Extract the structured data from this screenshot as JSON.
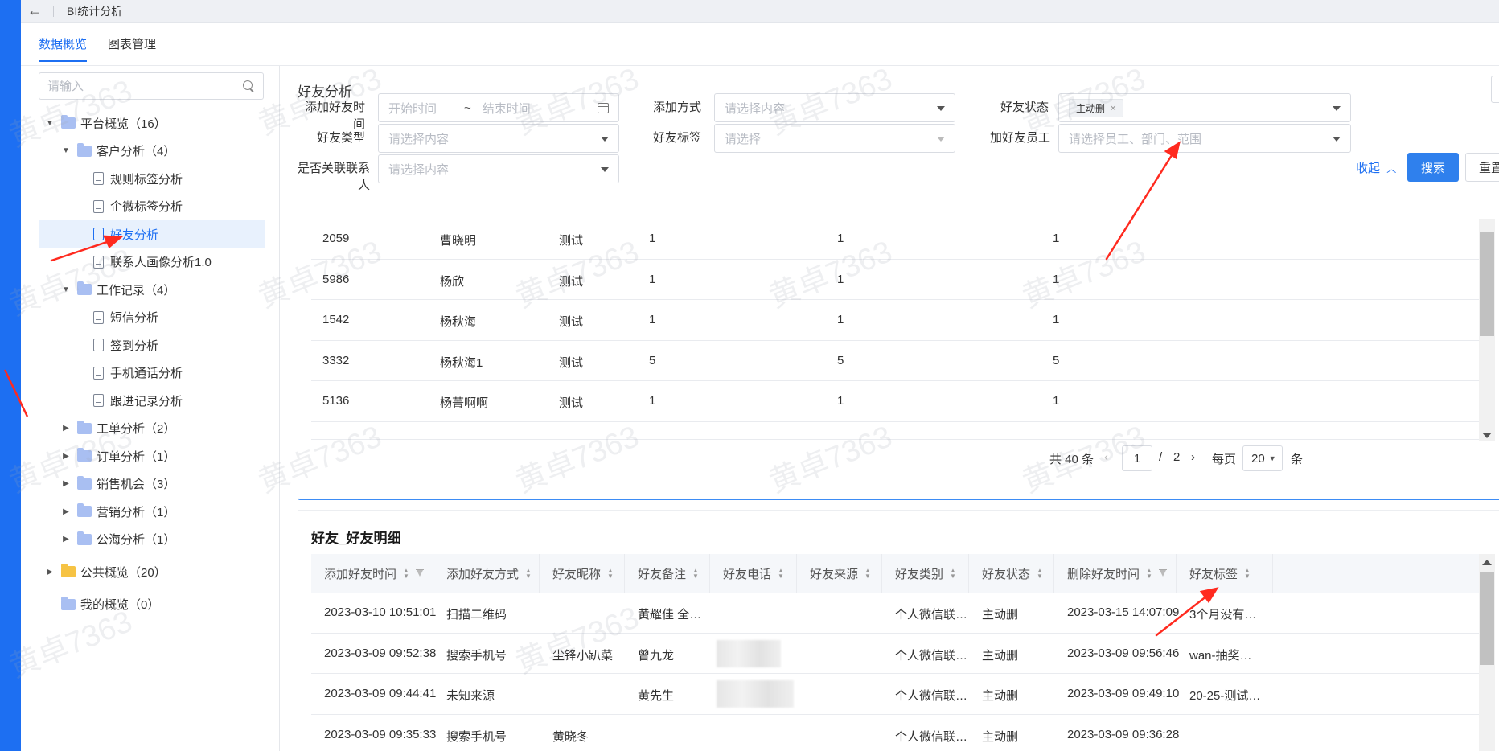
{
  "topbar": {
    "back_icon": "arrow-left-icon",
    "title": "BI统计分析"
  },
  "tabs": [
    {
      "label": "数据概览",
      "active": true
    },
    {
      "label": "图表管理",
      "active": false
    }
  ],
  "sidebar": {
    "search_placeholder": "请输入",
    "tree": [
      {
        "label": "平台概览（16）",
        "level": 0,
        "type": "folder",
        "expanded": true
      },
      {
        "label": "客户分析（4）",
        "level": 1,
        "type": "folder",
        "expanded": true
      },
      {
        "label": "规则标签分析",
        "level": 2,
        "type": "doc"
      },
      {
        "label": "企微标签分析",
        "level": 2,
        "type": "doc"
      },
      {
        "label": "好友分析",
        "level": 2,
        "type": "doc",
        "selected": true
      },
      {
        "label": "联系人画像分析1.0",
        "level": 2,
        "type": "doc"
      },
      {
        "label": "工作记录（4）",
        "level": 1,
        "type": "folder",
        "expanded": true
      },
      {
        "label": "短信分析",
        "level": 2,
        "type": "doc"
      },
      {
        "label": "签到分析",
        "level": 2,
        "type": "doc"
      },
      {
        "label": "手机通话分析",
        "level": 2,
        "type": "doc"
      },
      {
        "label": "跟进记录分析",
        "level": 2,
        "type": "doc"
      },
      {
        "label": "工单分析（2）",
        "level": 1,
        "type": "folder",
        "expanded": false
      },
      {
        "label": "订单分析（1）",
        "level": 1,
        "type": "folder",
        "expanded": false
      },
      {
        "label": "销售机会（3）",
        "level": 1,
        "type": "folder",
        "expanded": false
      },
      {
        "label": "营销分析（1）",
        "level": 1,
        "type": "folder",
        "expanded": false
      },
      {
        "label": "公海分析（1）",
        "level": 1,
        "type": "folder",
        "expanded": false
      },
      {
        "label": "公共概览（20）",
        "level": 0,
        "type": "folder-yellow",
        "expanded": false
      },
      {
        "label": "我的概览（0）",
        "level": 0,
        "type": "folder",
        "expanded": null
      }
    ]
  },
  "main": {
    "title": "好友分析",
    "export_icon": "upload-icon",
    "filters": {
      "add_time_label": "添加好友时间",
      "start_placeholder": "开始时间",
      "range_sep": "~",
      "end_placeholder": "结束时间",
      "add_method_label": "添加方式",
      "add_method_placeholder": "请选择内容",
      "status_label": "好友状态",
      "status_tag": "主动删",
      "status_tag_close": "×",
      "type_label": "好友类型",
      "type_placeholder": "请选择内容",
      "tag_label": "好友标签",
      "tag_placeholder": "请选择",
      "staff_label": "加好友员工",
      "staff_placeholder": "请选择员工、部门、范围",
      "linked_label": "是否关联联系人",
      "linked_placeholder": "请选择内容",
      "collapse_label": "收起",
      "search_label": "搜索",
      "reset_label": "重置"
    },
    "summary_table": {
      "rows": [
        [
          "2059",
          "曹晓明",
          "测试",
          "1",
          "1",
          "1"
        ],
        [
          "5986",
          "杨欣",
          "测试",
          "1",
          "1",
          "1"
        ],
        [
          "1542",
          "杨秋海",
          "测试",
          "1",
          "1",
          "1"
        ],
        [
          "3332",
          "杨秋海1",
          "测试",
          "5",
          "5",
          "5"
        ],
        [
          "5136",
          "杨菁啊啊",
          "测试",
          "1",
          "1",
          "1"
        ]
      ],
      "pagination": {
        "total_text": "共 40 条",
        "page": "1",
        "sep": "/",
        "pages": "2",
        "per_page_label": "每页",
        "per_page": "20",
        "unit": "条"
      }
    },
    "detail": {
      "title": "好友_好友明细",
      "columns": [
        "添加好友时间",
        "添加好友方式",
        "好友昵称",
        "好友备注",
        "好友电话",
        "好友来源",
        "好友类别",
        "好友状态",
        "删除好友时间",
        "好友标签"
      ],
      "rows": [
        [
          "2023-03-10 10:51:01",
          "扫描二维码",
          "",
          "黄耀佳 全…",
          "",
          "",
          "个人微信联…",
          "主动删",
          "2023-03-15 14:07:09",
          "3个月没有…"
        ],
        [
          "2023-03-09 09:52:38",
          "搜索手机号",
          "尘锋小趴菜",
          "曾九龙",
          "",
          "",
          "个人微信联…",
          "主动删",
          "2023-03-09 09:56:46",
          "wan-抽奖…"
        ],
        [
          "2023-03-09 09:44:41",
          "未知来源",
          "",
          "黄先生",
          "",
          "",
          "个人微信联…",
          "主动删",
          "2023-03-09 09:49:10",
          "20-25-测试…"
        ],
        [
          "2023-03-09 09:35:33",
          "搜索手机号",
          "黄晓冬",
          "",
          "",
          "",
          "个人微信联…",
          "主动删",
          "2023-03-09 09:36:28",
          ""
        ]
      ]
    }
  },
  "watermark": "黄卓7363",
  "colors": {
    "primary": "#1d6ff2",
    "annotation_red": "#ff2a1f"
  }
}
